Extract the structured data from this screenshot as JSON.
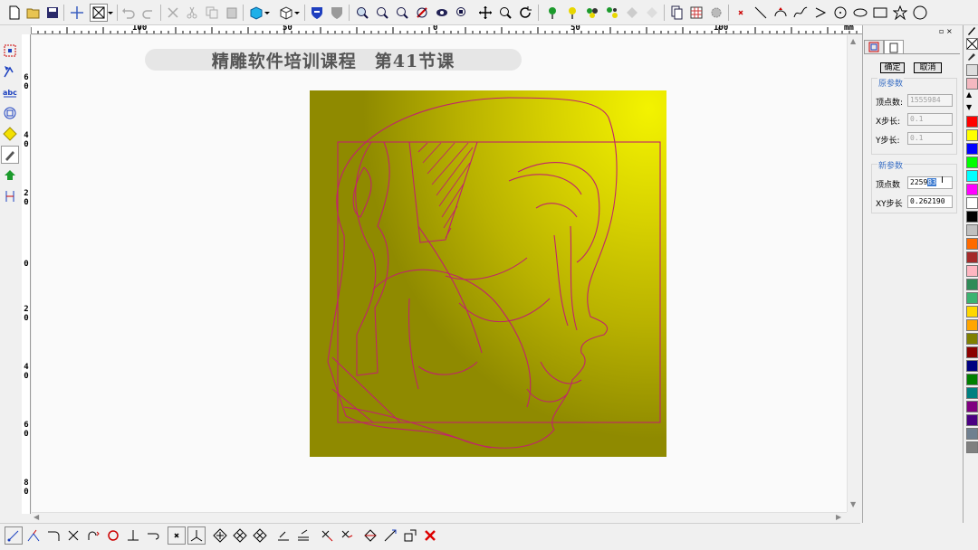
{
  "toolbar": {
    "buttons": [
      "new-file",
      "open-file",
      "save-file",
      "crosshair",
      "select-box",
      "undo",
      "redo",
      "cut",
      "scissors",
      "copy",
      "paste",
      "cube-color",
      "cube-view",
      "shield-blue",
      "shield-gray",
      "zoom-window",
      "zoom-in",
      "zoom-prev",
      "zoom-fit",
      "zoom-eye",
      "zoom-box",
      "pan",
      "zoom",
      "refresh",
      "node-green",
      "node-yellow",
      "node-multi",
      "node-star",
      "node-gray",
      "page-copy",
      "grid-table",
      "gear",
      "point",
      "line",
      "arc",
      "spline",
      "triangle",
      "circle-point",
      "ellipse",
      "rectangle",
      "star",
      "circle"
    ]
  },
  "ruler": {
    "h_labels": [
      "100",
      "50",
      "0",
      "50",
      "100",
      "mm"
    ],
    "v_labels": [
      "6",
      "0",
      "4",
      "0",
      "2",
      "0",
      "0",
      "2",
      "0",
      "4",
      "0",
      "6",
      "0",
      "8",
      "0"
    ]
  },
  "canvas": {
    "title": "精雕软件培训课程　第41节课",
    "artwork_name": "relief-face-artwork"
  },
  "panel": {
    "ok_label": "确定",
    "cancel_label": "取消",
    "orig_section": "原参数",
    "orig_vertex_label": "顶点数:",
    "orig_vertex_value": "1555984",
    "orig_x_label": "X步长:",
    "orig_x_value": "0.1",
    "orig_y_label": "Y步长:",
    "orig_y_value": "0.1",
    "new_section": "新参数",
    "new_vertex_label": "顶点数",
    "new_vertex_value_a": "2259",
    "new_vertex_value_b": "83",
    "new_xy_label": "XY步长",
    "new_xy_value": "0.262190"
  },
  "palette": {
    "colors": [
      "#f4b8c0",
      "#ff0000",
      "#ffff00",
      "#0000ff",
      "#00ff00",
      "#00ffff",
      "#ff00ff",
      "#ffffff",
      "#000000",
      "#c0c0c0",
      "#ff6a00",
      "#a52a2a",
      "#ffb6c1",
      "#2e8b57",
      "#3cb371",
      "#ffd700",
      "#ffa500",
      "#808000",
      "#8b0000",
      "#000080",
      "#008000",
      "#008080",
      "#800080",
      "#4b0082",
      "#708090",
      "#808080"
    ]
  },
  "bottom_tools": [
    "line-tool",
    "node-edit",
    "arc-edit",
    "trim",
    "extend",
    "circle-snap",
    "perpendicular",
    "tangent",
    "point-snap",
    "split",
    "diamond-1",
    "diamond-2",
    "diamond-3",
    "align-1",
    "align-2",
    "cross-1",
    "cross-2",
    "move-1",
    "move-2",
    "scale",
    "delete-red"
  ]
}
